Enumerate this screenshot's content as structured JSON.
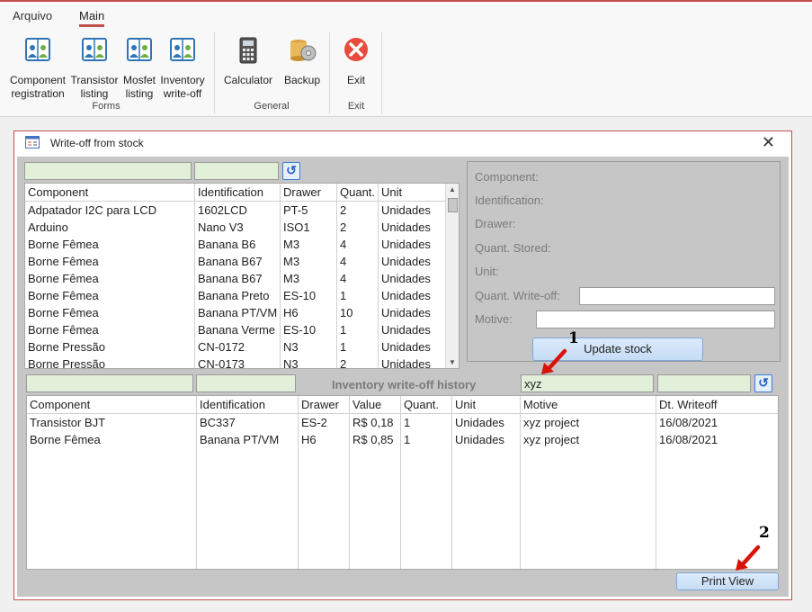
{
  "ribbon": {
    "tabs": [
      {
        "label": "Arquivo"
      },
      {
        "label": "Main"
      }
    ],
    "buttons": [
      {
        "label": "Component\nregistration",
        "icon": "people-book-icon"
      },
      {
        "label": "Transistor\nlisting",
        "icon": "people-book-icon"
      },
      {
        "label": "Mosfet\nlisting",
        "icon": "people-book-icon"
      },
      {
        "label": "Inventory\nwrite-off",
        "icon": "people-book-icon"
      },
      {
        "label": "Calculator",
        "icon": "calculator-icon"
      },
      {
        "label": "Backup",
        "icon": "backup-icon"
      },
      {
        "label": "Exit",
        "icon": "exit-icon"
      }
    ],
    "groups": [
      {
        "label": "Forms"
      },
      {
        "label": "General"
      },
      {
        "label": "Exit"
      }
    ]
  },
  "window": {
    "title": "Write-off from stock",
    "close": "✕"
  },
  "stock_list": {
    "columns": [
      "Component",
      "Identification",
      "Drawer",
      "Quant.",
      "Unit"
    ],
    "rows": [
      [
        "Adpatador I2C para LCD",
        "1602LCD",
        "PT-5",
        "2",
        "Unidades"
      ],
      [
        "Arduino",
        "Nano V3",
        "ISO1",
        "2",
        "Unidades"
      ],
      [
        "Borne Fêmea",
        "Banana B6",
        "M3",
        "4",
        "Unidades"
      ],
      [
        "Borne Fêmea",
        "Banana B67",
        "M3",
        "4",
        "Unidades"
      ],
      [
        "Borne Fêmea",
        "Banana B67",
        "M3",
        "4",
        "Unidades"
      ],
      [
        "Borne Fêmea",
        "Banana Preto",
        "ES-10",
        "1",
        "Unidades"
      ],
      [
        "Borne Fêmea",
        "Banana PT/VM",
        "H6",
        "10",
        "Unidades"
      ],
      [
        "Borne Fêmea",
        "Banana Verme",
        "ES-10",
        "1",
        "Unidades"
      ],
      [
        "Borne Pressão",
        "CN-0172",
        "N3",
        "1",
        "Unidades"
      ],
      [
        "Borne Pressão",
        "CN-0173",
        "N3",
        "2",
        "Unidades"
      ]
    ]
  },
  "detail": {
    "labels": [
      "Component:",
      "Identification:",
      "Drawer:",
      "Quant. Stored:",
      "Unit:",
      "Quant. Write-off:",
      "Motive:"
    ],
    "update_button": "Update stock"
  },
  "history": {
    "title": "Inventory write-off history",
    "filter_value": "xyz",
    "columns": [
      "Component",
      "Identification",
      "Drawer",
      "Value",
      "Quant.",
      "Unit",
      "Motive",
      "Dt. Writeoff"
    ],
    "rows": [
      [
        "Transistor BJT",
        "BC337",
        "ES-2",
        "R$ 0,18",
        "1",
        "Unidades",
        "xyz project",
        "16/08/2021"
      ],
      [
        "Borne Fêmea",
        "Banana PT/VM",
        "H6",
        "R$ 0,85",
        "1",
        "Unidades",
        "xyz project",
        "16/08/2021"
      ]
    ],
    "print_button": "Print View"
  },
  "annotations": {
    "first": "1",
    "second": "2",
    "arrow_color": "#d9130a"
  },
  "colors": {
    "accent": "#c0504d",
    "filter_bg": "#e2efd9",
    "panel_bg": "#c6c6c6",
    "button_bg": "#c5dcf5"
  }
}
